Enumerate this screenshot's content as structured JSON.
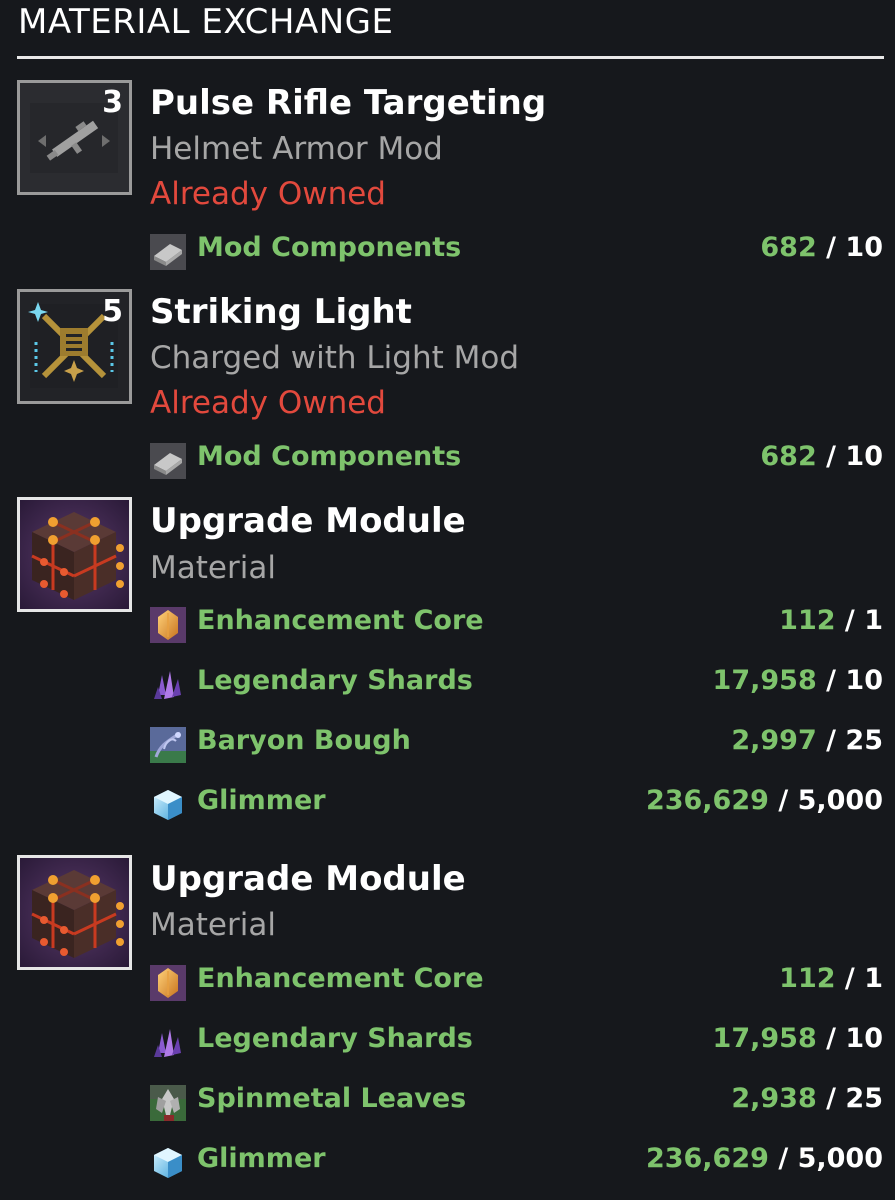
{
  "header": {
    "title": "MATERIAL EXCHANGE"
  },
  "items": [
    {
      "quantity": "3",
      "title": "Pulse Rifle Targeting",
      "subtitle": "Helmet Armor Mod",
      "status": "Already Owned",
      "icon": "pulse-rifle-icon",
      "costs": [
        {
          "name": "Mod Components",
          "have": "682",
          "sep": " / ",
          "need": "10",
          "icon": "mod-components-icon"
        }
      ]
    },
    {
      "quantity": "5",
      "title": "Striking Light",
      "subtitle": "Charged with Light Mod",
      "status": "Already Owned",
      "icon": "striking-light-icon",
      "costs": [
        {
          "name": "Mod Components",
          "have": "682",
          "sep": " / ",
          "need": "10",
          "icon": "mod-components-icon"
        }
      ]
    },
    {
      "title": "Upgrade Module",
      "subtitle": "Material",
      "icon": "upgrade-module-icon",
      "costs": [
        {
          "name": "Enhancement Core",
          "have": "112",
          "sep": " / ",
          "need": "1",
          "icon": "enhancement-core-icon"
        },
        {
          "name": "Legendary Shards",
          "have": "17,958",
          "sep": " / ",
          "need": "10",
          "icon": "legendary-shards-icon"
        },
        {
          "name": "Baryon Bough",
          "have": "2,997",
          "sep": " / ",
          "need": "25",
          "icon": "baryon-bough-icon"
        },
        {
          "name": "Glimmer",
          "have": "236,629",
          "sep": " / ",
          "need": "5,000",
          "icon": "glimmer-icon"
        }
      ]
    },
    {
      "title": "Upgrade Module",
      "subtitle": "Material",
      "icon": "upgrade-module-icon",
      "costs": [
        {
          "name": "Enhancement Core",
          "have": "112",
          "sep": " / ",
          "need": "1",
          "icon": "enhancement-core-icon"
        },
        {
          "name": "Legendary Shards",
          "have": "17,958",
          "sep": " / ",
          "need": "10",
          "icon": "legendary-shards-icon"
        },
        {
          "name": "Spinmetal Leaves",
          "have": "2,938",
          "sep": " / ",
          "need": "25",
          "icon": "spinmetal-leaves-icon"
        },
        {
          "name": "Glimmer",
          "have": "236,629",
          "sep": " / ",
          "need": "5,000",
          "icon": "glimmer-icon"
        }
      ]
    }
  ],
  "colors": {
    "background": "#16181c",
    "cost_green": "#7ec36c",
    "owned_red": "#e2493d",
    "subtitle_gray": "#a6a6a6"
  }
}
